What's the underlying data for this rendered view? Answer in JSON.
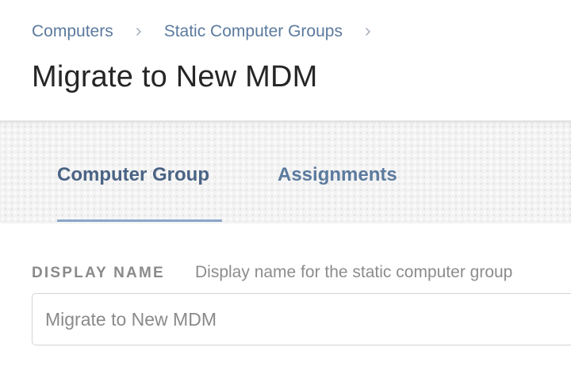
{
  "breadcrumb": {
    "items": [
      {
        "label": "Computers"
      },
      {
        "label": "Static Computer Groups"
      }
    ]
  },
  "page": {
    "title": "Migrate to New MDM"
  },
  "tabs": [
    {
      "label": "Computer Group",
      "active": true
    },
    {
      "label": "Assignments",
      "active": false
    }
  ],
  "form": {
    "display_name": {
      "label": "DISPLAY NAME",
      "help": "Display name for the static computer group",
      "value": "Migrate to New MDM"
    }
  },
  "colors": {
    "link": "#5b7a9e",
    "active_tab_underline": "#8aa6c8",
    "tabbar_bg": "#f3f3f3"
  },
  "icons": {
    "breadcrumb_separator": "chevron-right-icon"
  }
}
